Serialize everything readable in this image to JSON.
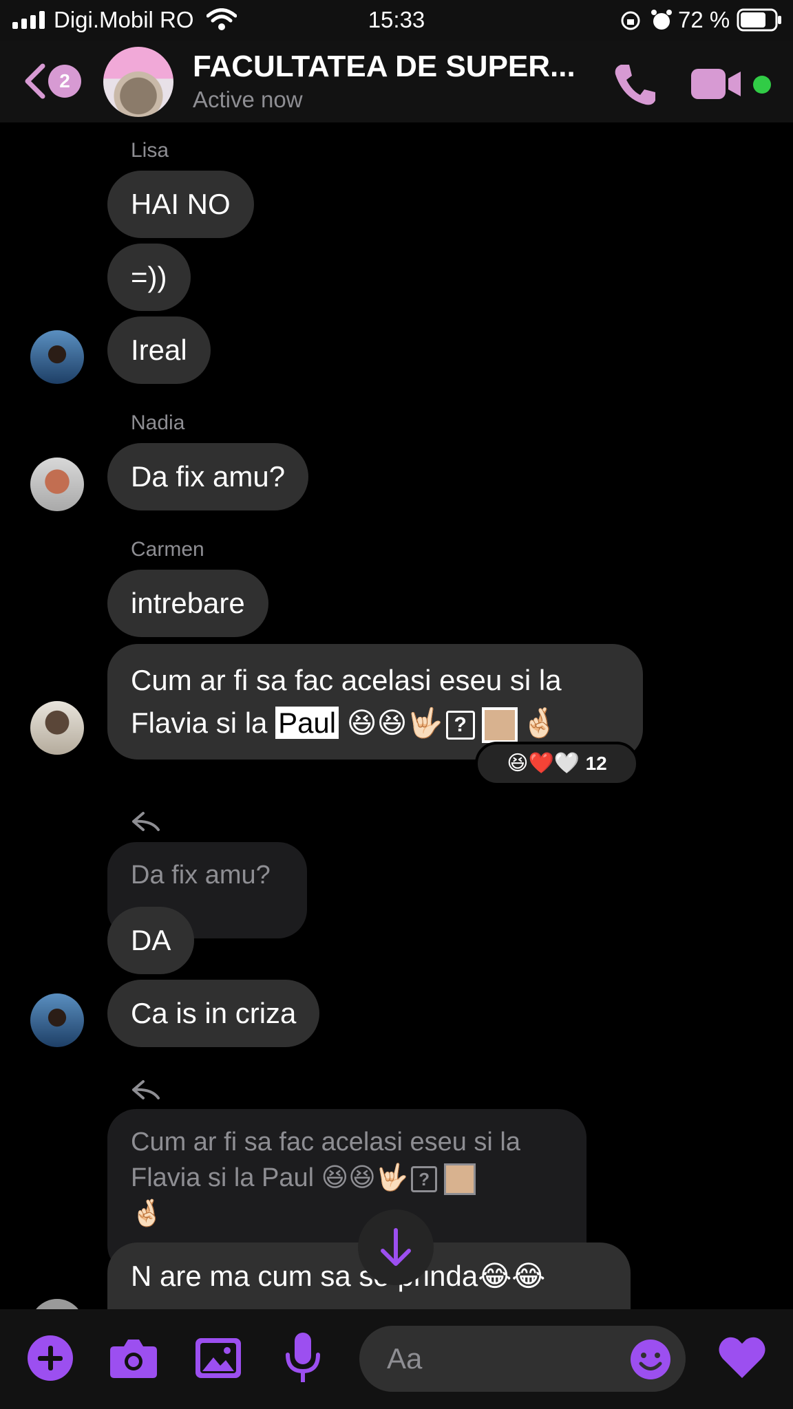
{
  "status_bar": {
    "carrier": "Digi.Mobil RO",
    "time": "15:33",
    "battery": "72 %"
  },
  "header": {
    "back_badge": "2",
    "title": "FACULTATEA DE SUPER...",
    "subtitle": "Active now",
    "accent_color": "#d79ad3",
    "online_color": "#31cc46"
  },
  "messages": {
    "lisa_name": "Lisa",
    "lisa_1": "HAI NO",
    "lisa_2": "=))",
    "lisa_3": "Ireal",
    "nadia_name": "Nadia",
    "nadia_1": "Da fix amu?",
    "carmen_name": "Carmen",
    "carmen_1": "intrebare",
    "carmen_2_part1": "Cum ar fi sa fac acelasi eseu si la Flavia si la ",
    "carmen_2_highlight": "Paul",
    "carmen_2_emoji": "😆😆🤟🏻",
    "carmen_2_unknown": "?",
    "carmen_2_end": "🤞🏻",
    "reaction_emojis": "😆❤️🤍",
    "reaction_count": "12",
    "reply1_quote": "Da fix amu?",
    "reply1_msg1": "DA",
    "reply1_msg2": "Ca is in criza",
    "reply2_quote_text": "Cum ar fi sa fac acelasi eseu si la Flavia si la Paul ",
    "reply2_quote_emoji": "😆😆🤟🏻",
    "reply2_quote_unknown": "?",
    "reply2_quote_end": "🤞🏻",
    "reply2_msg": "N are ma cum sa se prinda😂😂"
  },
  "composer": {
    "placeholder": "Aa",
    "accent_color": "#9c4ff0"
  },
  "icons": [
    "signal-icon",
    "wifi-icon",
    "lock-rotation-icon",
    "alarm-icon",
    "battery-icon",
    "back-chevron-icon",
    "phone-icon",
    "video-camera-icon",
    "reply-icon",
    "arrow-down-icon",
    "plus-icon",
    "camera-icon",
    "image-icon",
    "microphone-icon",
    "smiley-icon",
    "heart-icon"
  ]
}
